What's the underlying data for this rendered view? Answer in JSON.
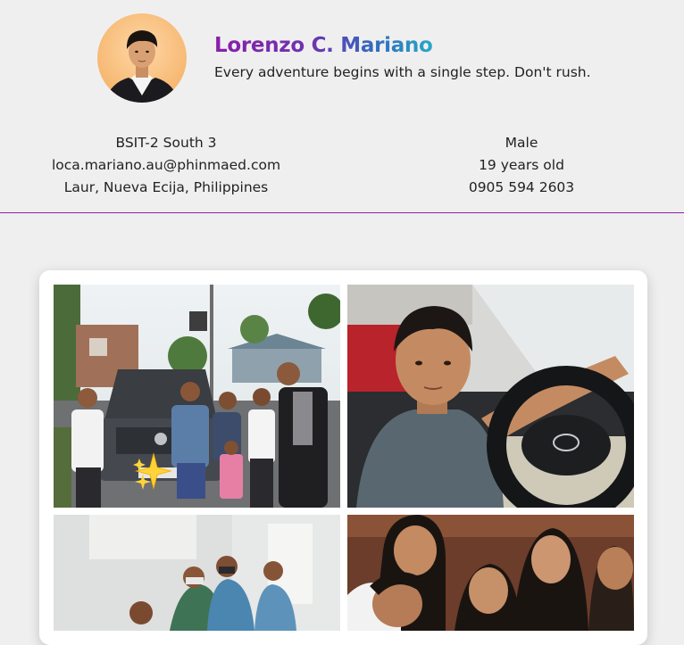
{
  "profile": {
    "name": "Lorenzo C. Mariano",
    "tagline": "Every adventure begins with a single step. Don't rush."
  },
  "info": {
    "left": [
      "BSIT-2 South 3",
      "loca.mariano.au@phinmaed.com",
      "Laur, Nueva Ecija, Philippines"
    ],
    "right": [
      "Male",
      "19 years old",
      "0905 594 2603"
    ]
  },
  "colors": {
    "name_gradient_start": "#8a1fa8",
    "name_gradient_end": "#27a9c6",
    "divider": "#8c1fa8",
    "background": "#f0eff0"
  },
  "icons": {
    "sparkle": "sparkles-icon"
  }
}
